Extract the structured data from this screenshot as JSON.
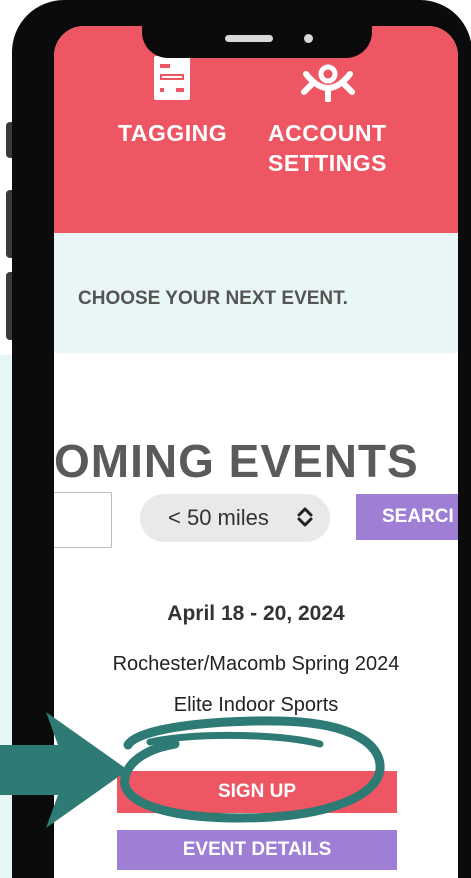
{
  "header": {
    "nav_items": [
      {
        "label": "TAGGING",
        "icon": "tag-reader-icon"
      },
      {
        "label": "ACCOUNT SETTINGS",
        "icon": "gear-icon"
      }
    ]
  },
  "banner": {
    "text": "CHOOSE YOUR NEXT EVENT."
  },
  "section": {
    "title": "UPCOMING EVENTS",
    "visible_title": "OMING EVENTS"
  },
  "search": {
    "zip_value": "",
    "radius_selected": "< 50 miles",
    "button_label": "SEARCH",
    "visible_button_label": "SEARCI"
  },
  "event": {
    "date": "April 18 - 20, 2024",
    "name": "Rochester/Macomb Spring 2024",
    "venue": "Elite Indoor Sports",
    "signup_label": "SIGN UP",
    "details_label": "EVENT DETAILS"
  },
  "annotation": {
    "arrow_icon": "arrow-right-icon",
    "highlight": "circle-highlight"
  },
  "colors": {
    "header_bg": "#ef5663",
    "banner_bg": "#e8f6f6",
    "accent_purple": "#9f7ed6",
    "annotation_teal": "#2e7a74"
  }
}
